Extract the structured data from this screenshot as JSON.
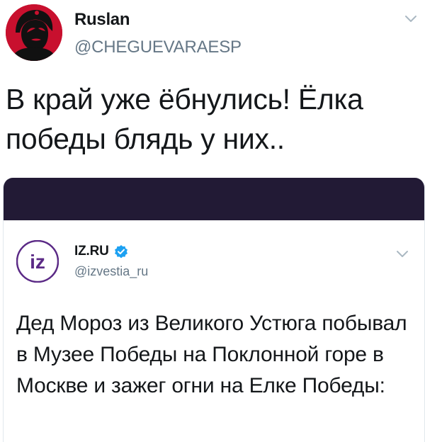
{
  "tweet": {
    "display_name": "Ruslan",
    "handle": "@CHEGUEVARAESP",
    "text": "В край уже ёбнулись! Ёлка победы блядь у них.."
  },
  "embedded_tweet": {
    "display_name": "IZ.RU",
    "handle": "@izvestia_ru",
    "logo_text": "iz",
    "text": "Дед Мороз из Великого Устюга побывал в Музее Победы на Поклонной горе в Москве и зажег огни на Елке Победы:"
  },
  "colors": {
    "avatar_red": "#c8102e",
    "handle_gray": "#657786",
    "banner_dark": "#221a35",
    "logo_purple": "#5b2a86",
    "verified_blue": "#1da1f2"
  },
  "icons": {
    "menu": "chevron-down-icon",
    "verified": "verified-badge-icon"
  }
}
